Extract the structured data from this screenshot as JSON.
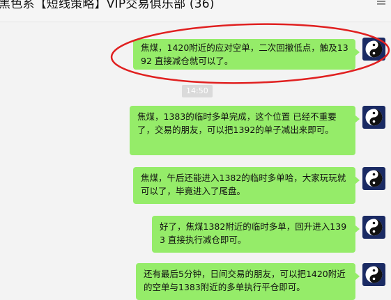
{
  "header": {
    "title": "黑色系【短线策略】VIP交易俱乐部 (36)"
  },
  "timestamp": "14:50",
  "messages": [
    {
      "text": "焦煤，1420附近的应对空单，二次回撤低点，触及1392  直接减仓就可以了。",
      "highlighted": true
    },
    {
      "text": "焦煤，1383的临时多单完成，这个位置 已经不重要了，交易的朋友，可以把1392的单子减出来即可。"
    },
    {
      "text": "焦煤，午后还能进入1382的临时多单哈，大家玩玩就可以了，毕竟进入了尾盘。"
    },
    {
      "text": "好了，焦煤1382附近的临时多单，回升进入1393  直接执行减仓即可。"
    },
    {
      "text": "还有最后5分钟，日间交易的朋友，可以把1420附近的空单与1383附近的多单执行平仓即可。"
    }
  ],
  "colors": {
    "bubble": "#95ec69",
    "highlight_ellipse": "#e02020",
    "avatar_bg": "#1a2a63"
  },
  "icons": {
    "avatar": "yin-yang-icon",
    "header_action": "more-icon"
  }
}
